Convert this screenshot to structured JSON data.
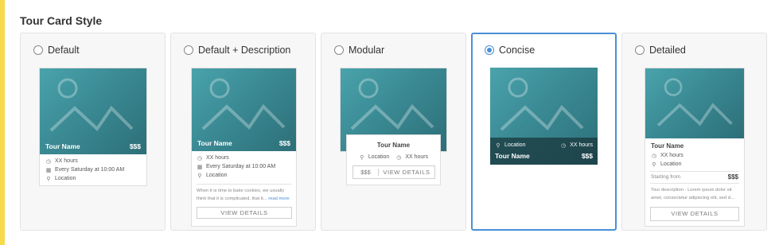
{
  "section": {
    "title": "Tour Card Style"
  },
  "options": [
    {
      "label": "Default",
      "selected": false
    },
    {
      "label": "Default + Description",
      "selected": false
    },
    {
      "label": "Modular",
      "selected": false
    },
    {
      "label": "Concise",
      "selected": true
    },
    {
      "label": "Detailed",
      "selected": false
    }
  ],
  "default_card": {
    "tour_name": "Tour Name",
    "price": "$$$",
    "hours": "XX hours",
    "schedule": "Every Saturday at 10:00 AM",
    "location": "Location"
  },
  "desc_card": {
    "tour_name": "Tour Name",
    "price": "$$$",
    "hours": "XX hours",
    "schedule": "Every Saturday at 10:00 AM",
    "location": "Location",
    "description_line1": "When it is time to bake cookies, we usually",
    "description_line2": "think that it is complicated, that it...",
    "read_more": "read more",
    "button": "VIEW DETAILS"
  },
  "modular_card": {
    "tour_name": "Tour Name",
    "location": "Location",
    "hours": "XX hours",
    "price": "$$$",
    "button": "VIEW DETAILS"
  },
  "concise_card": {
    "location": "Location",
    "hours": "XX hours",
    "tour_name": "Tour Name",
    "price": "$$$"
  },
  "detailed_card": {
    "tour_name": "Tour Name",
    "hours": "XX hours",
    "location": "Location",
    "starting_from": "Starting from",
    "price": "$$$",
    "description_line1": "Tour description - Lorem ipsum dolor sit",
    "description_line2": "amet, consectetur adipiscing elit, sed d...",
    "button": "VIEW DETAILS"
  },
  "colors": {
    "accent_bar": "#f7d94c",
    "selected_border": "#4a8fd6",
    "image_teal": "#3a8a94"
  },
  "icons": {
    "clock": "clock-icon",
    "calendar": "calendar-icon",
    "pin": "location-pin-icon",
    "placeholder": "image-placeholder-icon"
  }
}
